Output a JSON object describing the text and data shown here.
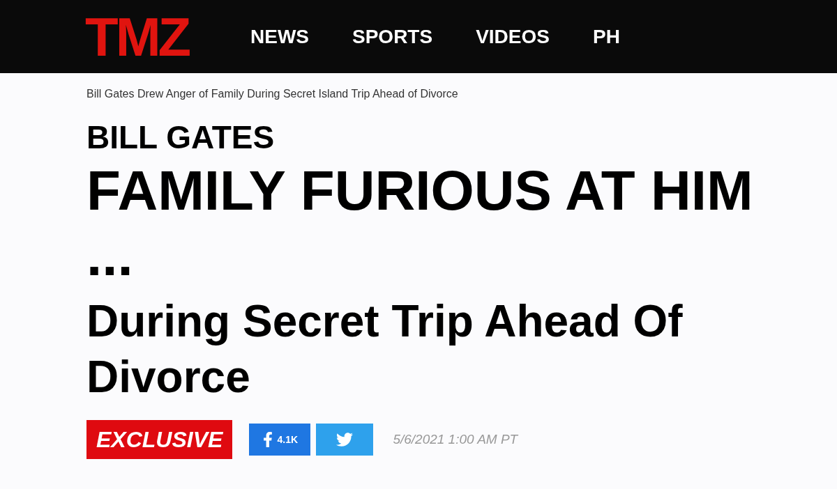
{
  "header": {
    "logo": "TMZ",
    "nav": [
      "NEWS",
      "SPORTS",
      "VIDEOS",
      "PH"
    ]
  },
  "breadcrumb": "Bill Gates Drew Anger of Family During Secret Island Trip Ahead of Divorce",
  "article": {
    "kicker": "BILL GATES",
    "headline": "FAMILY FURIOUS AT HIM ...",
    "subheadline": "During Secret Trip Ahead Of Divorce"
  },
  "meta": {
    "badge": "EXCLUSIVE",
    "facebook_count": "4.1K",
    "timestamp": "5/6/2021 1:00 AM PT"
  }
}
